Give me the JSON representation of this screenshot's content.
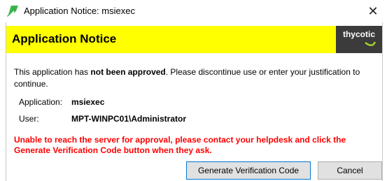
{
  "window": {
    "title": "Application Notice: msiexec",
    "close_glyph": "✕",
    "icon": "green-arrow-icon"
  },
  "banner": {
    "title": "Application Notice",
    "brand": "thycotic",
    "background": "#ffff00",
    "brand_background": "#3b3b3b"
  },
  "message": {
    "prefix": "This application has ",
    "emphasis": "not been approved",
    "suffix": ". Please discontinue use or enter your justification to continue."
  },
  "details": [
    {
      "label": "Application:",
      "value": "msiexec"
    },
    {
      "label": "User:",
      "value": "MPT-WINPC01\\Administrator"
    }
  ],
  "error": {
    "text": "Unable to reach the server for approval, please contact your helpdesk and click the Generate Verification Code button when they ask.",
    "color": "#ff0000"
  },
  "buttons": {
    "generate": "Generate Verification Code",
    "cancel": "Cancel"
  }
}
